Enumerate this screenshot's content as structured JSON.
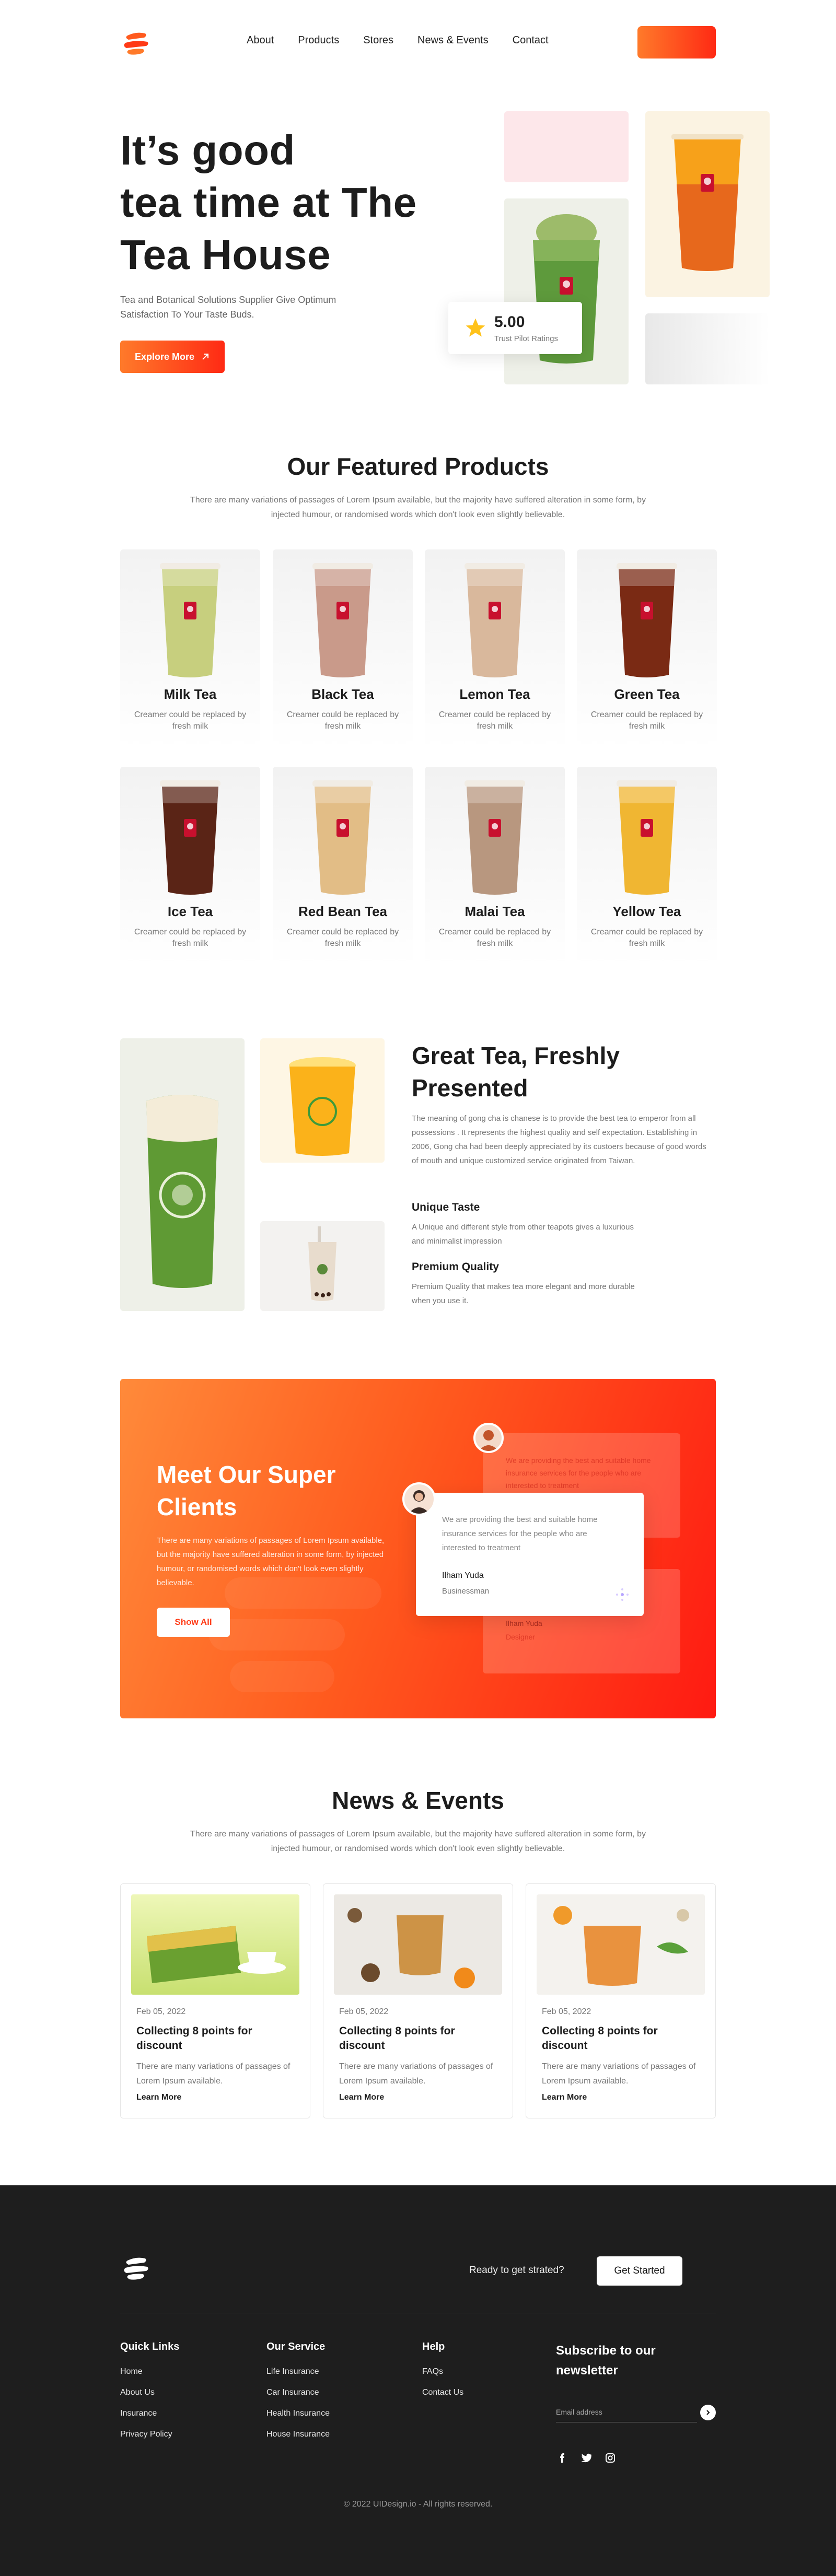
{
  "brand": {
    "accent_start": "#ff7a2a",
    "accent_end": "#ff2a14",
    "logo_icon": "tea-house-logo-icon"
  },
  "nav": {
    "links": [
      "About",
      "Products",
      "Stores",
      "News & Events",
      "Contact"
    ]
  },
  "hero": {
    "title_line1": "It’s good",
    "title_line2": "tea time at The",
    "title_line3": "Tea House",
    "subtitle": "Tea and Botanical Solutions Supplier Give Optimum Satisfaction To Your Taste Buds.",
    "cta_label": "Explore More",
    "rating_value": "5.00",
    "rating_label": "Trust Pilot Ratings"
  },
  "featured": {
    "title": "Our Featured Products",
    "description": "There are many variations of passages of Lorem Ipsum available, but the majority have suffered alteration in some form, by injected humour, or randomised words which don't look even slightly believable.",
    "products": [
      {
        "name": "Milk Tea",
        "desc": "Creamer could be replaced by fresh milk",
        "color": "#c7cf7e"
      },
      {
        "name": "Black Tea",
        "desc": "Creamer could be replaced by fresh milk",
        "color": "#c99a8a"
      },
      {
        "name": "Lemon Tea",
        "desc": "Creamer could be replaced by fresh milk",
        "color": "#d9b89c"
      },
      {
        "name": "Green Tea",
        "desc": "Creamer could be replaced by fresh milk",
        "color": "#7a2a14"
      },
      {
        "name": "Ice Tea",
        "desc": "Creamer could be replaced by fresh milk",
        "color": "#5a2416"
      },
      {
        "name": "Red Bean Tea",
        "desc": "Creamer could be replaced by fresh milk",
        "color": "#e2bd86"
      },
      {
        "name": "Malai Tea",
        "desc": "Creamer could be replaced by fresh milk",
        "color": "#b8977f"
      },
      {
        "name": "Yellow Tea",
        "desc": "Creamer could be replaced by fresh milk",
        "color": "#f0b632"
      }
    ]
  },
  "great_tea": {
    "title_line1": "Great Tea, Freshly",
    "title_line2": "Presented",
    "body": "The meaning of gong cha is chanese is to provide the best tea to emperor from all possessions . It represents the highest quality and self expectation. Establishing in 2006, Gong cha had been deeply appreciated by its custoers because of good words of mouth and unique customized service originated from Taiwan.",
    "feature1_title": "Unique Taste",
    "feature1_text": "A Unique and different style from other teapots gives a luxurious and minimalist impression",
    "feature2_title": "Premium Quality",
    "feature2_text": "Premium Quality that makes tea more elegant and more durable when you use it."
  },
  "clients": {
    "title_line1": "Meet Our Super",
    "title_line2": "Clients",
    "description": "There are many variations of passages of Lorem Ipsum available, but the majority have suffered alteration in some form, by injected humour, or randomised words which don't look even slightly believable.",
    "button": "Show All",
    "testimonial_text": "We are providing the best and suitable home insurance services for the people who are interested to treatment",
    "testimonial_name": "Ilham Yuda",
    "testimonial_role": "Businessman",
    "ghost_text": "We are providing the best and suitable home insurance services for the people who are interested to treatment",
    "ghost_name": "Ilham Yuda",
    "ghost_role": "Designer"
  },
  "news": {
    "title": "News & Events",
    "description": "There are many variations of passages of Lorem Ipsum available, but the majority have suffered alteration in some form, by injected humour, or randomised words which don't look even slightly believable.",
    "items": [
      {
        "date": "Feb 05, 2022",
        "title": "Collecting 8 points for discount",
        "desc": "There are many variations of passages of Lorem Ipsum available.",
        "more": "Learn More"
      },
      {
        "date": "Feb 05, 2022",
        "title": "Collecting 8 points for discount",
        "desc": "There are many variations of passages of Lorem Ipsum available.",
        "more": "Learn More"
      },
      {
        "date": "Feb 05, 2022",
        "title": "Collecting 8 points for discount",
        "desc": "There are many variations of passages of Lorem Ipsum available.",
        "more": "Learn More"
      }
    ]
  },
  "footer": {
    "ready_text": "Ready to get strated?",
    "cta": "Get Started",
    "quick_links": {
      "title": "Quick Links",
      "items": [
        "Home",
        "About Us",
        "Insurance",
        "Privacy Policy"
      ]
    },
    "our_service": {
      "title": "Our Service",
      "items": [
        "Life Insurance",
        "Car Insurance",
        "Health Insurance",
        "House Insurance"
      ]
    },
    "help": {
      "title": "Help",
      "items": [
        "FAQs",
        "Contact Us"
      ]
    },
    "subscribe_title": "Subscribe to our newsletter",
    "email_placeholder": "Email address",
    "social_icons": [
      "facebook-icon",
      "twitter-icon",
      "instagram-icon"
    ],
    "copyright": "© 2022 UIDesign.io - All rights reserved."
  }
}
